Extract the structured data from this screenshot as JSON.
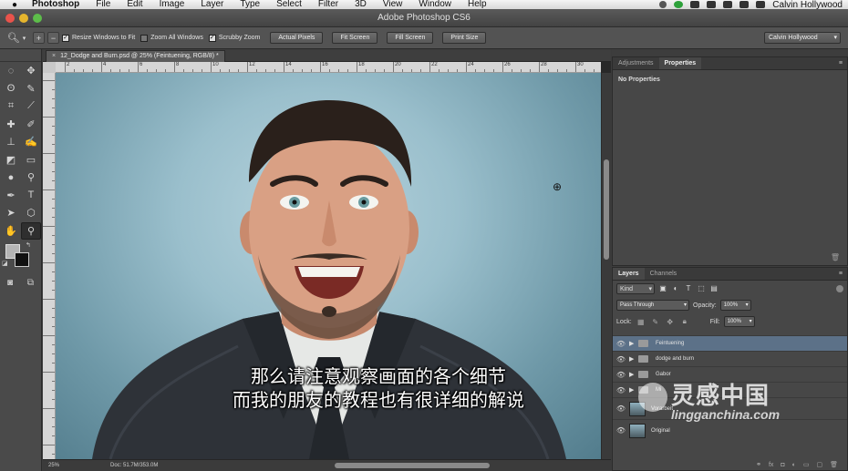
{
  "menubar": {
    "app": "Photoshop",
    "items": [
      "File",
      "Edit",
      "Image",
      "Layer",
      "Type",
      "Select",
      "Filter",
      "3D",
      "View",
      "Window",
      "Help"
    ],
    "user": "Calvin Hollywood"
  },
  "window": {
    "title": "Adobe Photoshop CS6"
  },
  "options": {
    "resize_windows": "Resize Windows to Fit",
    "zoom_all": "Zoom All Windows",
    "scrubby_zoom": "Scrubby Zoom",
    "actual_pixels": "Actual Pixels",
    "fit_screen": "Fit Screen",
    "fill_screen": "Fill Screen",
    "print_size": "Print Size",
    "workspace": "Calvin Hollywood"
  },
  "document": {
    "tab": "12_Dodge and Burn.psd @ 25% (Feintuening, RGB/8) *",
    "zoom": "25%",
    "doc_info": "Doc: 51.7M/353.0M",
    "ruler_labels": [
      "2",
      "4",
      "6",
      "8",
      "10",
      "12",
      "14",
      "16",
      "18",
      "20",
      "22",
      "24",
      "26",
      "28",
      "30"
    ]
  },
  "subtitles": {
    "line1": "那么请注意观察画面的各个细节",
    "line2": "而我的朋友的教程也有很详细的解说"
  },
  "properties_panel": {
    "tabs": [
      "Adjustments",
      "Properties"
    ],
    "active_tab": "Properties",
    "content": "No Properties"
  },
  "layers_panel": {
    "tabs": [
      "Layers",
      "Channels"
    ],
    "filter_kind": "Kind",
    "blend_mode": "Pass Through",
    "opacity_label": "Opacity:",
    "opacity": "100%",
    "lock_label": "Lock:",
    "fill_label": "Fill:",
    "fill": "100%",
    "layers": [
      {
        "name": "Feintuening",
        "type": "group",
        "selected": true
      },
      {
        "name": "dodge and burn",
        "type": "group",
        "selected": false
      },
      {
        "name": "Gabor",
        "type": "group",
        "selected": false
      },
      {
        "name": "Mi",
        "type": "group",
        "selected": false
      },
      {
        "name": "Vorarbeit",
        "type": "pixel",
        "selected": false
      },
      {
        "name": "Original",
        "type": "pixel",
        "selected": false
      }
    ]
  },
  "watermark": {
    "cn": "灵感中国",
    "url": "lingganchina.com"
  }
}
